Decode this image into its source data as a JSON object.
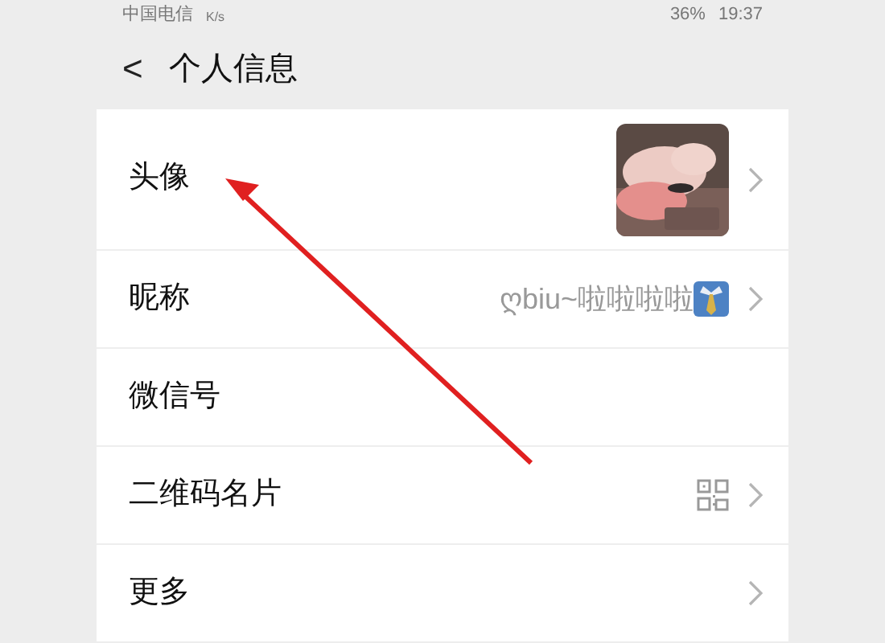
{
  "status_bar": {
    "carrier": "中国电信",
    "speed": "K/s",
    "battery": "36%",
    "time": "19:37"
  },
  "header": {
    "back": "<",
    "title": "个人信息"
  },
  "rows": [
    {
      "kind": "avatar",
      "label": "头像"
    },
    {
      "kind": "nickname",
      "label": "昵称",
      "value": "ღbiu~啦啦啦啦"
    },
    {
      "kind": "plain",
      "label": "微信号"
    },
    {
      "kind": "qrcode",
      "label": "二维码名片"
    },
    {
      "kind": "link",
      "label": "更多"
    }
  ]
}
